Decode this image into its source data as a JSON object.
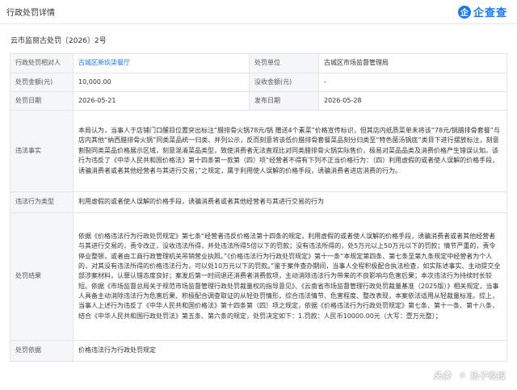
{
  "header": {
    "title": "行政处罚详情",
    "logo_mark": "企",
    "logo_text": "企查查"
  },
  "doc_number": "云市监丽古处罚〔2026〕2号",
  "rows": {
    "party_label": "行政处罚相对人",
    "party_value": "古城区新玖柒餐厅",
    "authority_label": "处罚单位",
    "authority_value": "古城区市场监督管理局",
    "amount_label": "处罚金额(元)",
    "amount_value": "10,000.00",
    "confiscated_label": "没收金额(元)",
    "confiscated_value": "-",
    "date_label": "处罚日期",
    "date_value": "2026-05-21",
    "publish_label": "发布日期",
    "publish_value": "2026-05-28",
    "facts_label": "违法事实",
    "facts_value": "本局认为，当事人于店铺门口醒目位置突出标注“腊排骨火锅78元/锅 赠送4个素菜”价格宣传标识，但其店内纸质菜单未将该“78元/锅腊排骨套餐”与店内其他“纳西腊排骨火锅”同类菜品统一归类、并列公示，反而刻意将该低价腊排骨套餐菜品刻分归类至“特色菌汤锅底”类目下进行摆放标注，刻意割裂同类菜品价格展示区域，刻意混淆菜品类型，致使消费者无法直观比对同类腊排骨火锅实际售价，极易对菜品品类及消费价格产生错误认知。该行为违反了《中华人民共和国价格法》第十四条第一款第（四）项“经营者不得有下列不正当价格行为：（四）利用虚假的或者使人误解的价格手段，诱骗消费者或者其他经营者与其进行交易；”之规定，属于利用使人误解的价格手段，诱骗消费者进店消费的行为。",
    "type_label": "违法行为类型",
    "type_value": "利用虚假的或者使人误解的价格手段，诱骗消费者或者其他经营者与其进行交易的行为",
    "result_label": "处罚结果",
    "result_value": "依据《价格违法行为行政处罚规定》第七条“经营者违反价格法第十四条的规定，利用虚假的或者使人误解的价格手段，诱骗消费者或者其他经营者与其进行交易的，责令改正，没收违法所得，并处违法所得5倍以下的罚款；没有违法所得的，处5万元以上50万元以下的罚款；情节严重的，责令停业整顿，或者由工商行政管理机关吊销营业执照。”《价格违法行为行政处罚规定》第十一条“本规定第四条、第七条至第九条规定中经营者为个人的，对其没有违法所得的价格违法行为，可以处10万元以下的罚款。”鉴于案件查办期间，当事人全程积极配合执法检查，如实陈述事实、主动提交全部涉案材料，认罪认错态度良好；案发后第一时间退还消费者消费款项，主动消除违法行为带来的不良影响与危害后果；本次违法行为持续时长较短。依据《市场监督总局关于规范市场监督管理行政处罚裁量权的指导意见》、《云南省市场监督管理行政处罚裁量基准（2025版）》相关规定，当事人具备主动消除违法行为危害后果、积极配合调查取证的从轻处罚情形，综合违法情节、危害程度、整改表现，本案依法适用从轻裁量标准。综上，当事人上述行为违反了《中华人民共和国价格法》第十四条第（四）项之规定，依据《价格违法行为行政处罚规定》第七条、第十一条、第十八条，结合《中华人民共和国行政处罚法》第五条、第六条的规定，处罚决定如下：1.罚款：人民币10000.00元（大写：壹万元整）；",
    "basis_label": "处罚依据",
    "basis_value": "价格违法行为行政处罚规定"
  },
  "watermark": {
    "logo": "头条",
    "brand": "扬子晚报"
  }
}
